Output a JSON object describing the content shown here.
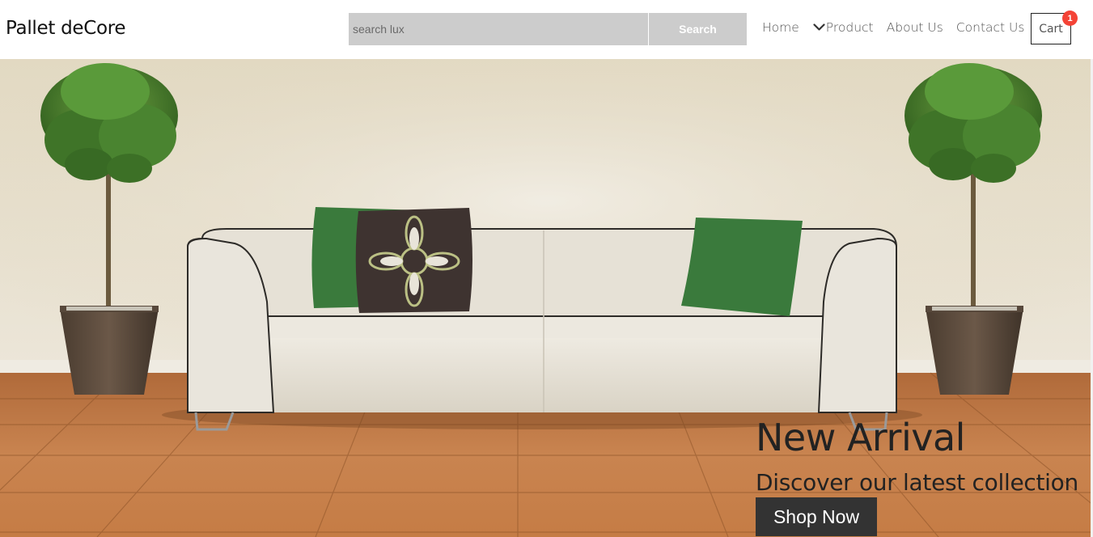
{
  "brand": {
    "name": "Pallet deCore"
  },
  "search": {
    "placeholder": "search lux",
    "button_label": "Search"
  },
  "nav": {
    "items": [
      {
        "label": "Home"
      },
      {
        "label": "Product"
      },
      {
        "label": "About Us"
      },
      {
        "label": "Contact Us"
      }
    ]
  },
  "cart": {
    "label": "Cart",
    "count": "1"
  },
  "hero": {
    "title": "New Arrival",
    "subtitle": "Discover our latest collection",
    "cta_label": "Shop Now"
  },
  "icons": {
    "product_dropdown": "chevron-down-icon"
  },
  "colors": {
    "search_bg": "#cccccc",
    "badge": "#f44336",
    "cta_bg": "#333333",
    "cushion_green": "#3a7a3c",
    "floor": "#c07a44"
  }
}
